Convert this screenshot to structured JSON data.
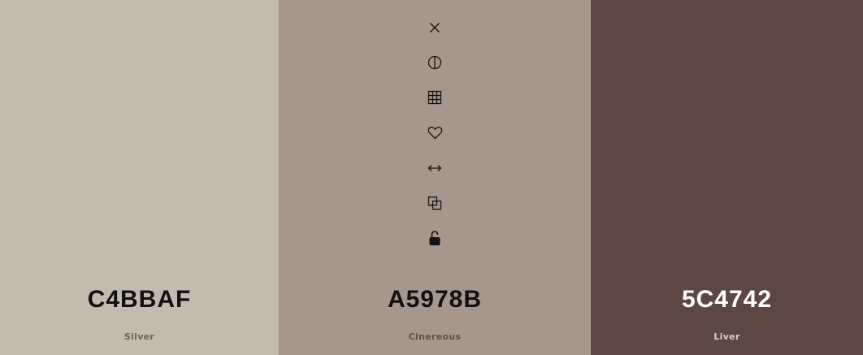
{
  "swatches": [
    {
      "hex": "C4BBAF",
      "name": "Silver",
      "bg": "#c4bbaf",
      "text_color": "#111111",
      "name_color": "#6b645c"
    },
    {
      "hex": "A5978B",
      "name": "Cinereous",
      "bg": "#a5978b",
      "text_color": "#111111",
      "name_color": "#5a5149"
    },
    {
      "hex": "5C4742",
      "name": "Liver",
      "bg": "#5c4742",
      "text_color": "#ffffff",
      "name_color": "#d8cfcc"
    }
  ],
  "toolbar": {
    "icons": [
      "close-icon",
      "contrast-icon",
      "grid-icon",
      "heart-icon",
      "arrows-horizontal-icon",
      "copy-icon",
      "unlock-icon"
    ]
  }
}
